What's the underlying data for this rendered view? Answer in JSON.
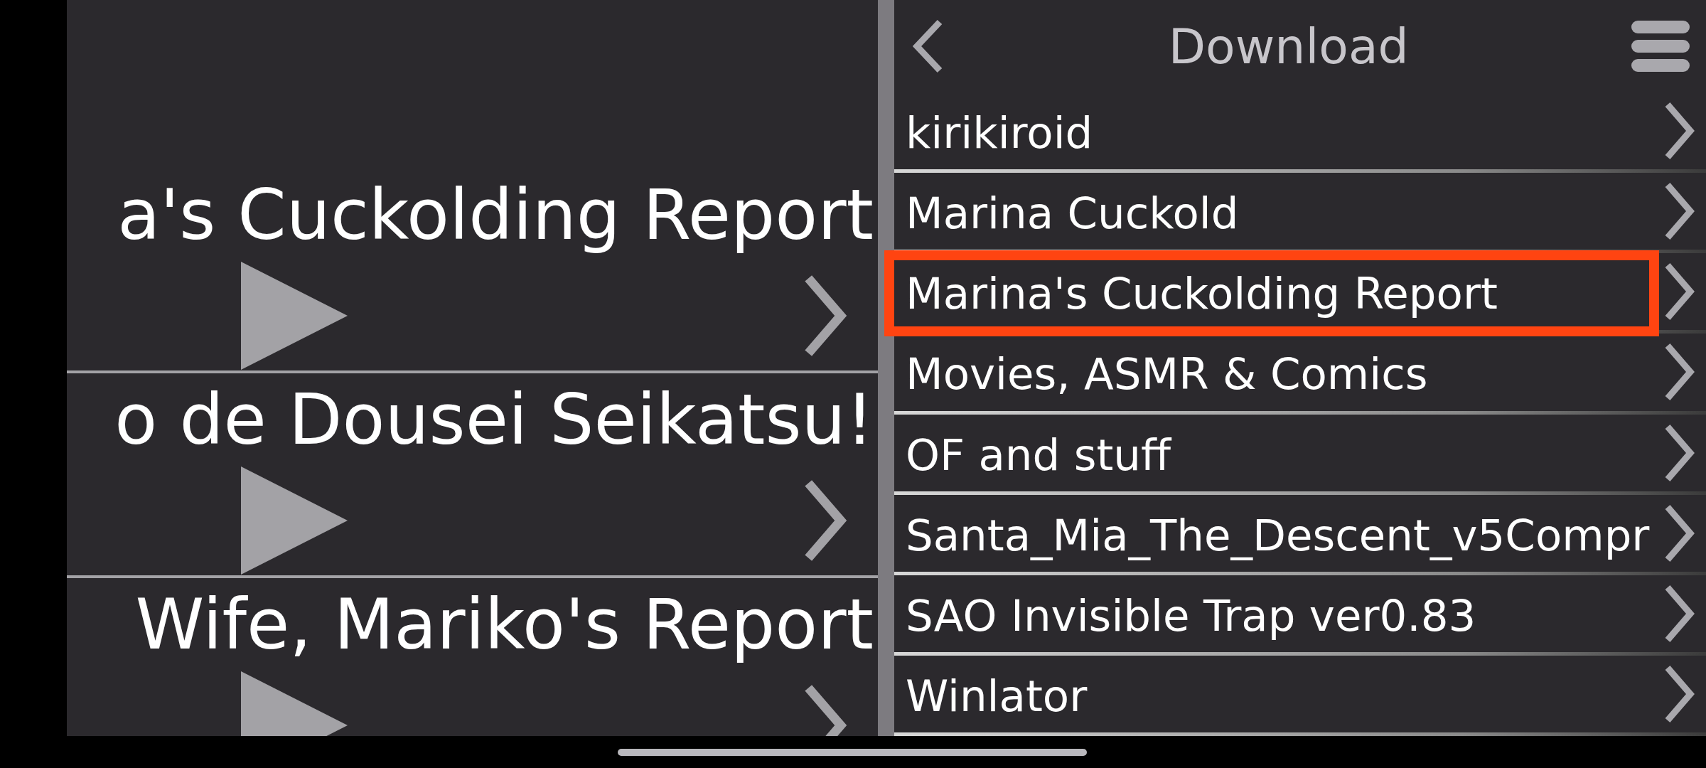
{
  "left_panel": {
    "rows": [
      {
        "title": "a's Cuckolding Report"
      },
      {
        "title": "o de Dousei Seikatsu!"
      },
      {
        "title": "Wife, Mariko's Report"
      }
    ]
  },
  "right_panel": {
    "title": "Download",
    "items": [
      {
        "label": "kirikiroid",
        "highlighted": false
      },
      {
        "label": "Marina Cuckold",
        "highlighted": false
      },
      {
        "label": "Marina's Cuckolding Report",
        "highlighted": true
      },
      {
        "label": "Movies, ASMR & Comics",
        "highlighted": false
      },
      {
        "label": "OF and stuff",
        "highlighted": false
      },
      {
        "label": "Santa_Mia_The_Descent_v5Compr",
        "highlighted": false
      },
      {
        "label": "SAO Invisible Trap ver0.83",
        "highlighted": false
      },
      {
        "label": "Winlator",
        "highlighted": false
      }
    ]
  }
}
